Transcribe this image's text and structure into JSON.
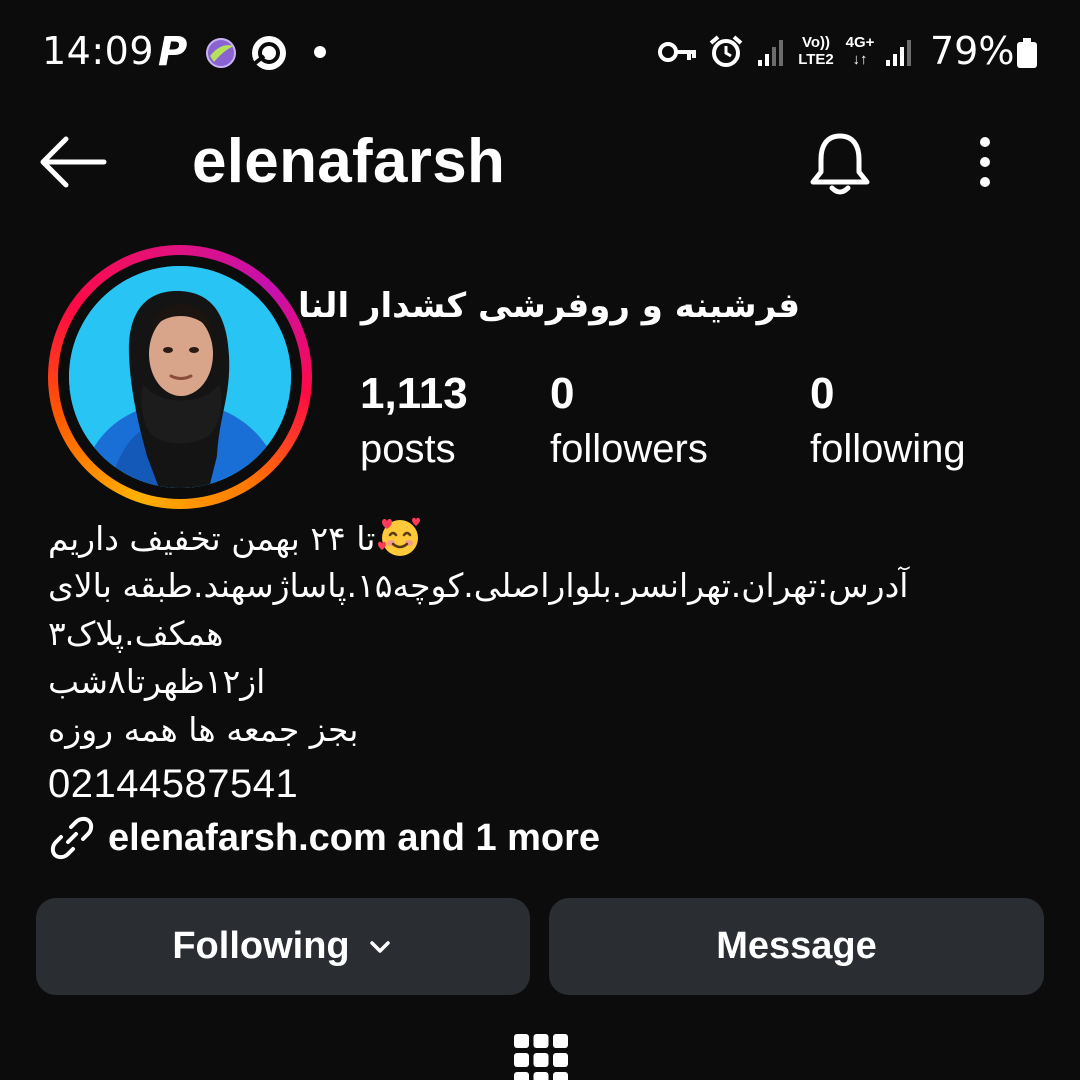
{
  "status_bar": {
    "time": "14:09",
    "volte_top": "Vo))",
    "volte_bottom": "LTE2",
    "network_top": "4G+",
    "network_bottom": "↓↑",
    "battery": "79%"
  },
  "header": {
    "username": "elenafarsh"
  },
  "profile": {
    "display_name": "فرشینه و روفرشی کشدار النا",
    "stats": [
      {
        "count": "1,113",
        "label": "posts"
      },
      {
        "count": "0",
        "label": "followers"
      },
      {
        "count": "0",
        "label": "following"
      }
    ]
  },
  "bio": {
    "line1": "تا ۲۴ بهمن تخفیف داریم",
    "line2": "آدرس:تهران.تهرانسر.بلواراصلی.کوچه۱۵.پاساژسهند.طبقه بالای",
    "line3": "همکف.پلاک۳",
    "line4": "از۱۲ظهرتا۸شب",
    "line5": "بجز جمعه ها همه روزه",
    "phone": "02144587541",
    "link": "elenafarsh.com and 1 more"
  },
  "actions": {
    "following_label": "Following",
    "message_label": "Message"
  },
  "icons": {
    "back": "arrow-left-icon",
    "bell": "bell-icon",
    "more": "more-vertical-icon",
    "link": "link-icon",
    "chevron": "chevron-down-icon",
    "grid": "grid-icon",
    "emoji": "smiling-face-with-hearts-icon"
  },
  "colors": {
    "background": "#0c0c0c",
    "button": "#2a2e33",
    "text": "#ffffff",
    "story_ring_start": "#ffb100",
    "story_ring_end": "#c710b0"
  }
}
